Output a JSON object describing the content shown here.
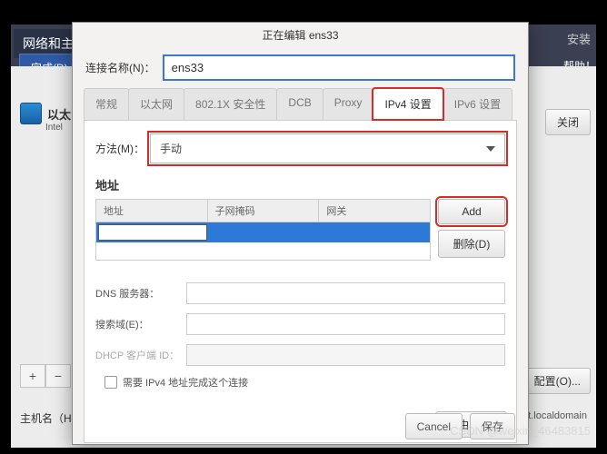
{
  "window": {
    "title": "网络和主机",
    "done": "完成(D)",
    "install": "安装",
    "help": "帮助！",
    "close": "关闭",
    "configure": "配置(O)...",
    "hostname_label": "主机名（H）",
    "hostname_value": "alhost.localdomain",
    "nic_label": "以太",
    "nic_sub": "Intel"
  },
  "dialog": {
    "title": "正在编辑 ens33",
    "conn_name_label": "连接名称(N)：",
    "conn_name_value": "ens33",
    "tabs": {
      "general": "常规",
      "ethernet": "以太网",
      "security": "802.1X 安全性",
      "dcb": "DCB",
      "proxy": "Proxy",
      "ipv4": "IPv4 设置",
      "ipv6": "IPv6 设置"
    },
    "method_label": "方法(M)：",
    "method_value": "手动",
    "addresses_label": "地址",
    "cols": {
      "addr": "地址",
      "mask": "子网掩码",
      "gw": "网关"
    },
    "add_btn": "Add",
    "delete_btn": "删除(D)",
    "fields": {
      "dns": "DNS 服务器：",
      "search": "搜索域(E)：",
      "dhcp": "DHCP 客户端 ID：",
      "require": "需要 IPv4 地址完成这个连接"
    },
    "routes_btn": "路由(R)…",
    "cancel": "Cancel",
    "save": "保存"
  },
  "watermark": "CSDN @weixin_46483815"
}
